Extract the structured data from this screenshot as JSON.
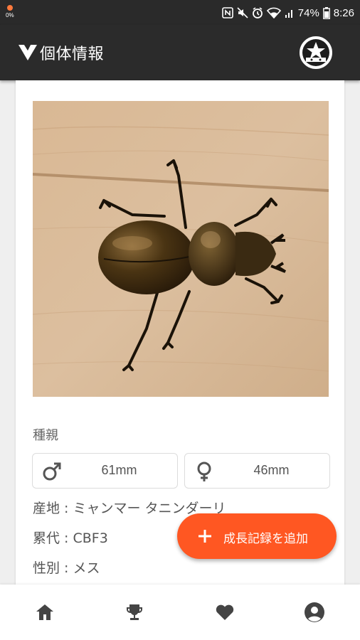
{
  "status_bar": {
    "battery_percent": "74%",
    "time": "8:26",
    "notification_icon": "app-notification-icon",
    "icons": [
      "nfc-icon",
      "mute-icon",
      "alarm-icon",
      "wifi-icon",
      "signal-icon",
      "battery-icon"
    ]
  },
  "app_bar": {
    "title": "個体情報",
    "logo_icon": "app-logo-icon",
    "profile_icon": "profile-badge-icon"
  },
  "photo": {
    "subject": "stag-beetle-photo"
  },
  "parents": {
    "label": "種親",
    "male": {
      "icon": "male-icon",
      "value": "61mm"
    },
    "female": {
      "icon": "female-icon",
      "value": "46mm"
    }
  },
  "details": {
    "origin_label": "産地",
    "origin_value": "ミャンマー タニンダーリ",
    "generation_label": "累代",
    "generation_value": "CBF3",
    "sex_label": "性別",
    "sex_value": "メス",
    "separator": " : "
  },
  "fab": {
    "label": "成長記録を追加",
    "icon": "plus-icon"
  },
  "bottom_nav": {
    "items": [
      {
        "name": "home",
        "icon": "home-icon"
      },
      {
        "name": "trophy",
        "icon": "trophy-icon"
      },
      {
        "name": "favorites",
        "icon": "heart-icon"
      },
      {
        "name": "account",
        "icon": "account-icon"
      }
    ]
  },
  "colors": {
    "app_bar": "#2b2b2b",
    "fab": "#ff5722",
    "nav_icon": "#444444"
  }
}
